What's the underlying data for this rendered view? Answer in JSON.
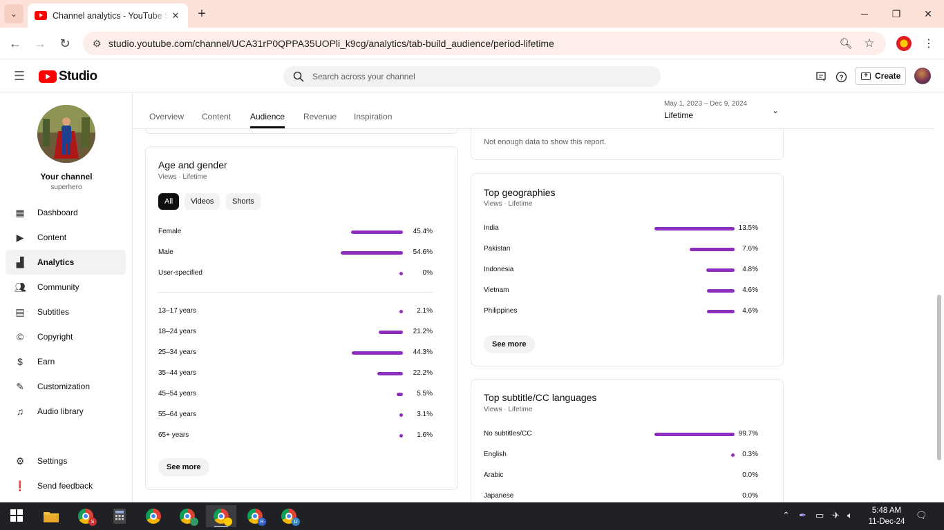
{
  "browser": {
    "tab_title": "Channel analytics - YouTube Studio",
    "url": "studio.youtube.com/channel/UCA31rP0QPPA35UOPli_k9cg/analytics/tab-build_audience/period-lifetime"
  },
  "header": {
    "logo_text": "Studio",
    "search_placeholder": "Search across your channel",
    "create_label": "Create"
  },
  "sidebar": {
    "channel_name": "Your channel",
    "channel_handle": "superhero",
    "items": [
      {
        "label": "Dashboard",
        "icon": "dashboard-icon"
      },
      {
        "label": "Content",
        "icon": "content-icon"
      },
      {
        "label": "Analytics",
        "icon": "analytics-icon",
        "active": true
      },
      {
        "label": "Community",
        "icon": "community-icon"
      },
      {
        "label": "Subtitles",
        "icon": "subtitles-icon"
      },
      {
        "label": "Copyright",
        "icon": "copyright-icon"
      },
      {
        "label": "Earn",
        "icon": "earn-icon"
      },
      {
        "label": "Customization",
        "icon": "customization-icon"
      },
      {
        "label": "Audio library",
        "icon": "audio-library-icon"
      }
    ],
    "bottom": [
      {
        "label": "Settings",
        "icon": "settings-icon"
      },
      {
        "label": "Send feedback",
        "icon": "feedback-icon"
      }
    ]
  },
  "tabs": [
    "Overview",
    "Content",
    "Audience",
    "Revenue",
    "Inspiration"
  ],
  "active_tab": "Audience",
  "period": {
    "range": "May 1, 2023 – Dec 9, 2024",
    "label": "Lifetime"
  },
  "not_enough": "Not enough data to show this report.",
  "age_gender": {
    "title": "Age and gender",
    "subtitle": "Views · Lifetime",
    "filters": [
      "All",
      "Videos",
      "Shorts"
    ],
    "gender": [
      {
        "label": "Female",
        "value": "45.4%",
        "pct": 45.4
      },
      {
        "label": "Male",
        "value": "54.6%",
        "pct": 54.6
      },
      {
        "label": "User-specified",
        "value": "0%",
        "pct": 0
      }
    ],
    "age": [
      {
        "label": "13–17 years",
        "value": "2.1%",
        "pct": 2.1
      },
      {
        "label": "18–24 years",
        "value": "21.2%",
        "pct": 21.2
      },
      {
        "label": "25–34 years",
        "value": "44.3%",
        "pct": 44.3
      },
      {
        "label": "35–44 years",
        "value": "22.2%",
        "pct": 22.2
      },
      {
        "label": "45–54 years",
        "value": "5.5%",
        "pct": 5.5
      },
      {
        "label": "55–64 years",
        "value": "3.1%",
        "pct": 3.1
      },
      {
        "label": "65+ years",
        "value": "1.6%",
        "pct": 1.6
      }
    ],
    "see_more": "See more"
  },
  "geographies": {
    "title": "Top geographies",
    "subtitle": "Views · Lifetime",
    "rows": [
      {
        "label": "India",
        "value": "13.5%",
        "pct": 13.5
      },
      {
        "label": "Pakistan",
        "value": "7.6%",
        "pct": 7.6
      },
      {
        "label": "Indonesia",
        "value": "4.8%",
        "pct": 4.8
      },
      {
        "label": "Vietnam",
        "value": "4.6%",
        "pct": 4.6
      },
      {
        "label": "Philippines",
        "value": "4.6%",
        "pct": 4.6
      }
    ],
    "see_more": "See more"
  },
  "subtitles_card": {
    "title": "Top subtitle/CC languages",
    "subtitle": "Views · Lifetime",
    "rows": [
      {
        "label": "No subtitles/CC",
        "value": "99.7%",
        "pct": 99.7
      },
      {
        "label": "English",
        "value": "0.3%",
        "pct": 0.3
      },
      {
        "label": "Arabic",
        "value": "0.0%",
        "pct": 0
      },
      {
        "label": "Japanese",
        "value": "0.0%",
        "pct": 0
      }
    ]
  },
  "taskbar": {
    "time": "5:48 AM",
    "date": "11-Dec-24"
  },
  "colors": {
    "bar": "#8d2fbe",
    "brand": "#ff0000"
  }
}
